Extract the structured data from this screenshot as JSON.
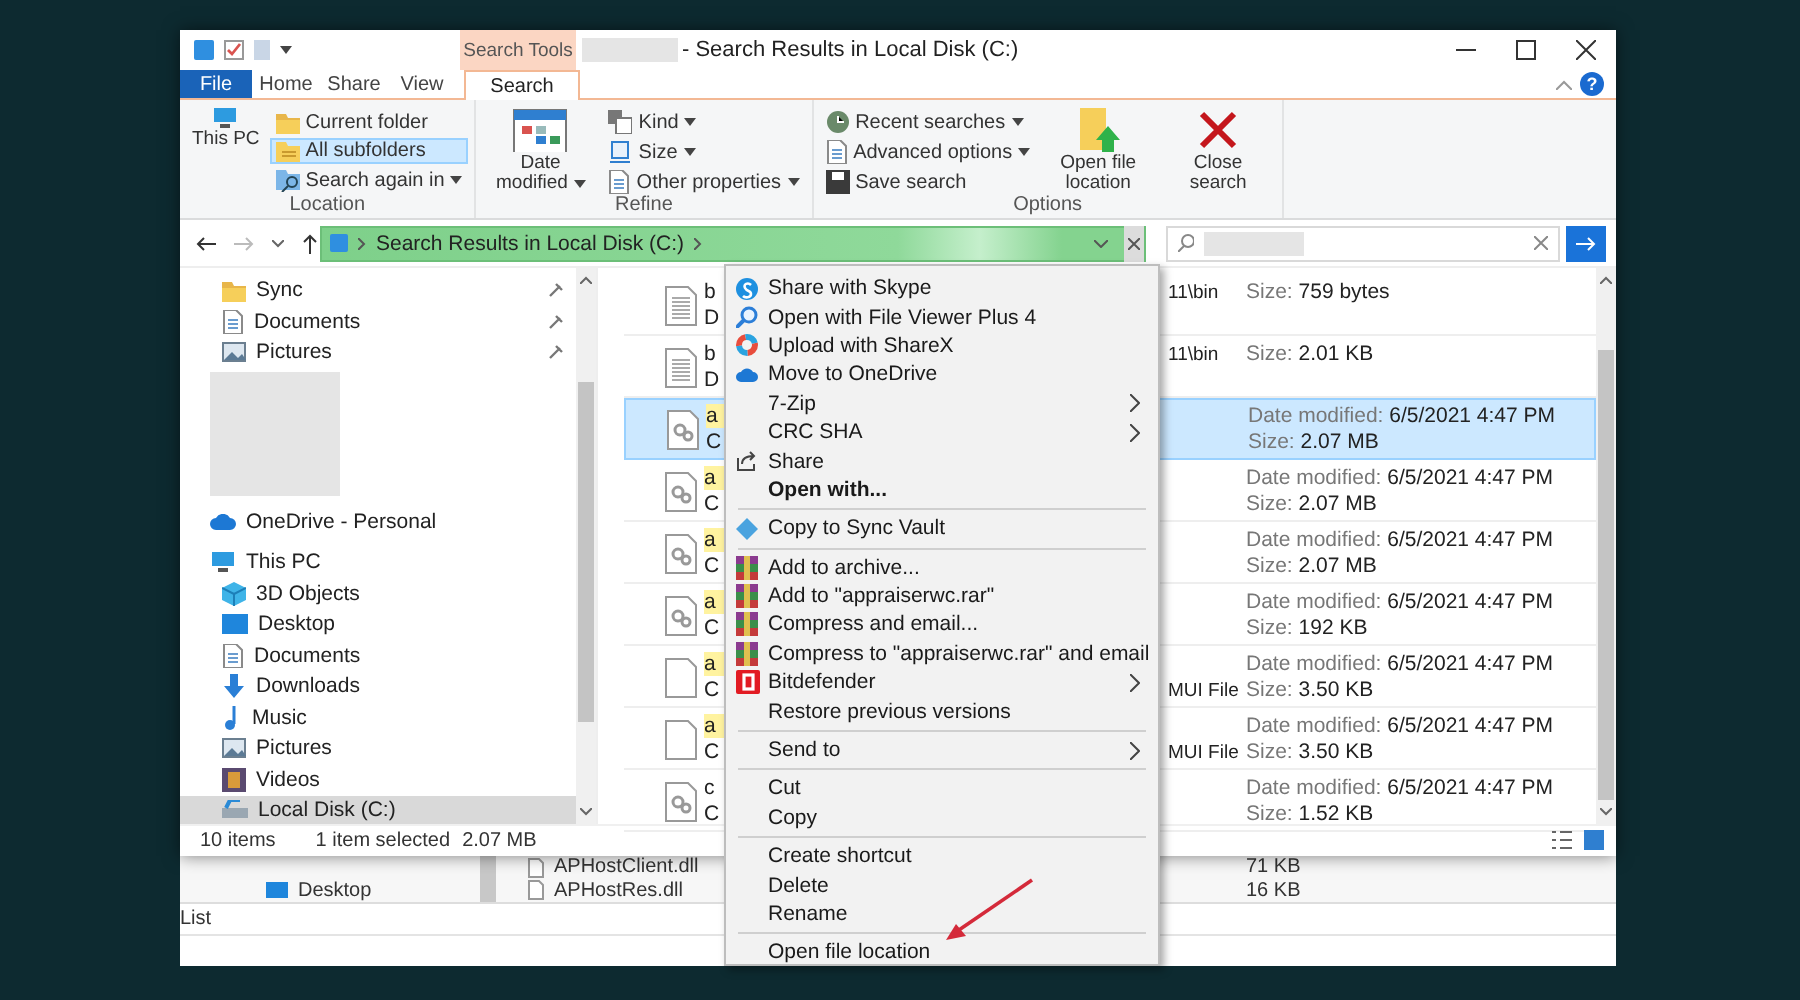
{
  "title_bar": {
    "context_tab_label": "Search Tools",
    "title": "- Search Results in Local Disk (C:)"
  },
  "ribbon_tabs": [
    {
      "label": "File",
      "kind": "file",
      "selected": false
    },
    {
      "label": "Home",
      "kind": "tab",
      "selected": false
    },
    {
      "label": "Share",
      "kind": "tab",
      "selected": false
    },
    {
      "label": "View",
      "kind": "tab",
      "selected": false
    },
    {
      "label": "Search",
      "kind": "context",
      "selected": true
    }
  ],
  "help_button": "?",
  "ribbon_groups": [
    {
      "label": "Location",
      "buttons": [
        {
          "label": "This PC",
          "kind": "large",
          "dropdown": false,
          "selected": false
        },
        {
          "label": "Current folder",
          "kind": "small",
          "dropdown": false,
          "selected": false
        },
        {
          "label": "All subfolders",
          "kind": "small",
          "dropdown": false,
          "selected": true
        },
        {
          "label": "Search again in",
          "kind": "small",
          "dropdown": true,
          "selected": false
        }
      ]
    },
    {
      "label": "Refine",
      "buttons": [
        {
          "label": "Date modified",
          "kind": "large",
          "dropdown": true,
          "selected": false
        },
        {
          "label": "Kind",
          "kind": "small",
          "dropdown": true,
          "selected": false
        },
        {
          "label": "Size",
          "kind": "small",
          "dropdown": true,
          "selected": false
        },
        {
          "label": "Other properties",
          "kind": "small",
          "dropdown": true,
          "selected": false
        }
      ]
    },
    {
      "label": "Options",
      "buttons": [
        {
          "label": "Recent searches",
          "kind": "small",
          "dropdown": true,
          "selected": false
        },
        {
          "label": "Advanced options",
          "kind": "small",
          "dropdown": true,
          "selected": false
        },
        {
          "label": "Save search",
          "kind": "small",
          "dropdown": false,
          "selected": false
        },
        {
          "label": "Open file location",
          "kind": "large",
          "dropdown": false,
          "selected": false
        },
        {
          "label": "Close search",
          "kind": "large",
          "dropdown": false,
          "selected": false
        }
      ]
    }
  ],
  "address_bar": {
    "path": "Search Results in Local Disk (C:)"
  },
  "navigation": {
    "quick_access": [
      {
        "label": "Sync",
        "pinned": true,
        "selected": false
      },
      {
        "label": "Documents",
        "pinned": true,
        "selected": false
      },
      {
        "label": "Pictures",
        "pinned": true,
        "selected": false
      }
    ],
    "onedrive": {
      "label": "OneDrive - Personal",
      "selected": false
    },
    "this_pc": {
      "label": "This PC",
      "selected": false,
      "children": [
        {
          "label": "3D Objects",
          "selected": false
        },
        {
          "label": "Desktop",
          "selected": false
        },
        {
          "label": "Documents",
          "selected": false
        },
        {
          "label": "Downloads",
          "selected": false
        },
        {
          "label": "Music",
          "selected": false
        },
        {
          "label": "Pictures",
          "selected": false
        },
        {
          "label": "Videos",
          "selected": false
        },
        {
          "label": "Local Disk (C:)",
          "selected": true
        }
      ]
    }
  },
  "results": [
    {
      "kind": "text",
      "name": "b",
      "location": "D",
      "highlighted": false,
      "selected": false,
      "column_3": "11\\bin",
      "details": [
        {
          "label": "Size:",
          "value": "759 bytes"
        }
      ]
    },
    {
      "kind": "text",
      "name": "b",
      "location": "D",
      "highlighted": false,
      "selected": false,
      "column_3": "11\\bin",
      "details": [
        {
          "label": "Size:",
          "value": "2.01 KB"
        }
      ]
    },
    {
      "kind": "system",
      "name": "a",
      "location": "C",
      "highlighted": true,
      "selected": true,
      "details": [
        {
          "label": "Date modified:",
          "value": "6/5/2021 4:47 PM"
        },
        {
          "label": "Size:",
          "value": "2.07 MB"
        }
      ]
    },
    {
      "kind": "system",
      "name": "a",
      "location": "C",
      "highlighted": true,
      "selected": false,
      "details": [
        {
          "label": "Date modified:",
          "value": "6/5/2021 4:47 PM"
        },
        {
          "label": "Size:",
          "value": "2.07 MB"
        }
      ]
    },
    {
      "kind": "system",
      "name": "a",
      "location": "C",
      "highlighted": true,
      "selected": false,
      "details": [
        {
          "label": "Date modified:",
          "value": "6/5/2021 4:47 PM"
        },
        {
          "label": "Size:",
          "value": "2.07 MB"
        }
      ]
    },
    {
      "kind": "system",
      "name": "a",
      "location": "C",
      "highlighted": true,
      "selected": false,
      "details": [
        {
          "label": "Date modified:",
          "value": "6/5/2021 4:47 PM"
        },
        {
          "label": "Size:",
          "value": "192 KB"
        }
      ]
    },
    {
      "kind": "blank",
      "name": "a",
      "location": "C",
      "highlighted": true,
      "selected": false,
      "column_3": "MUI File",
      "details": [
        {
          "label": "Date modified:",
          "value": "6/5/2021 4:47 PM"
        },
        {
          "label": "Size:",
          "value": "3.50 KB"
        }
      ]
    },
    {
      "kind": "blank",
      "name": "a",
      "location": "C",
      "highlighted": true,
      "selected": false,
      "column_3": "MUI File",
      "details": [
        {
          "label": "Date modified:",
          "value": "6/5/2021 4:47 PM"
        },
        {
          "label": "Size:",
          "value": "3.50 KB"
        }
      ]
    },
    {
      "kind": "system",
      "name": "c",
      "location": "C",
      "highlighted": false,
      "selected": false,
      "details": [
        {
          "label": "Date modified:",
          "value": "6/5/2021 4:47 PM"
        },
        {
          "label": "Size:",
          "value": "1.52 KB"
        }
      ]
    }
  ],
  "status_bar": {
    "item_count": "10 items",
    "selection": "1 item selected",
    "selection_size": "2.07 MB"
  },
  "background_window": {
    "nav_item": "Desktop",
    "files": [
      {
        "name": "APHostClient.dll",
        "size": "71 KB"
      },
      {
        "name": "APHostRes.dll",
        "size": "16 KB"
      }
    ],
    "view_label": "List"
  },
  "context_menu": [
    {
      "kind": "item",
      "label": "Share with Skype",
      "submenu": false,
      "default": false
    },
    {
      "kind": "item",
      "label": "Open with File Viewer Plus 4",
      "submenu": false,
      "default": false
    },
    {
      "kind": "item",
      "label": "Upload with ShareX",
      "submenu": false,
      "default": false
    },
    {
      "kind": "item",
      "label": "Move to OneDrive",
      "submenu": false,
      "default": false
    },
    {
      "kind": "item",
      "label": "7-Zip",
      "submenu": true,
      "default": false
    },
    {
      "kind": "item",
      "label": "CRC SHA",
      "submenu": true,
      "default": false
    },
    {
      "kind": "item",
      "label": "Share",
      "submenu": false,
      "default": false
    },
    {
      "kind": "item",
      "label": "Open with...",
      "submenu": false,
      "default": true
    },
    {
      "kind": "separator"
    },
    {
      "kind": "item",
      "label": "Copy to Sync Vault",
      "submenu": false,
      "default": false
    },
    {
      "kind": "separator"
    },
    {
      "kind": "item",
      "label": "Add to archive...",
      "submenu": false,
      "default": false
    },
    {
      "kind": "item",
      "label": "Add to \"appraiserwc.rar\"",
      "submenu": false,
      "default": false
    },
    {
      "kind": "item",
      "label": "Compress and email...",
      "submenu": false,
      "default": false
    },
    {
      "kind": "item",
      "label": "Compress to \"appraiserwc.rar\" and email",
      "submenu": false,
      "default": false
    },
    {
      "kind": "item",
      "label": "Bitdefender",
      "submenu": true,
      "default": false
    },
    {
      "kind": "item",
      "label": "Restore previous versions",
      "submenu": false,
      "default": false
    },
    {
      "kind": "separator"
    },
    {
      "kind": "item",
      "label": "Send to",
      "submenu": true,
      "default": false
    },
    {
      "kind": "separator"
    },
    {
      "kind": "item",
      "label": "Cut",
      "submenu": false,
      "default": false
    },
    {
      "kind": "item",
      "label": "Copy",
      "submenu": false,
      "default": false
    },
    {
      "kind": "separator"
    },
    {
      "kind": "item",
      "label": "Create shortcut",
      "submenu": false,
      "default": false
    },
    {
      "kind": "item",
      "label": "Delete",
      "submenu": false,
      "default": false
    },
    {
      "kind": "item",
      "label": "Rename",
      "submenu": false,
      "default": false
    },
    {
      "kind": "separator"
    },
    {
      "kind": "item",
      "label": "Open file location",
      "submenu": false,
      "default": false
    }
  ]
}
